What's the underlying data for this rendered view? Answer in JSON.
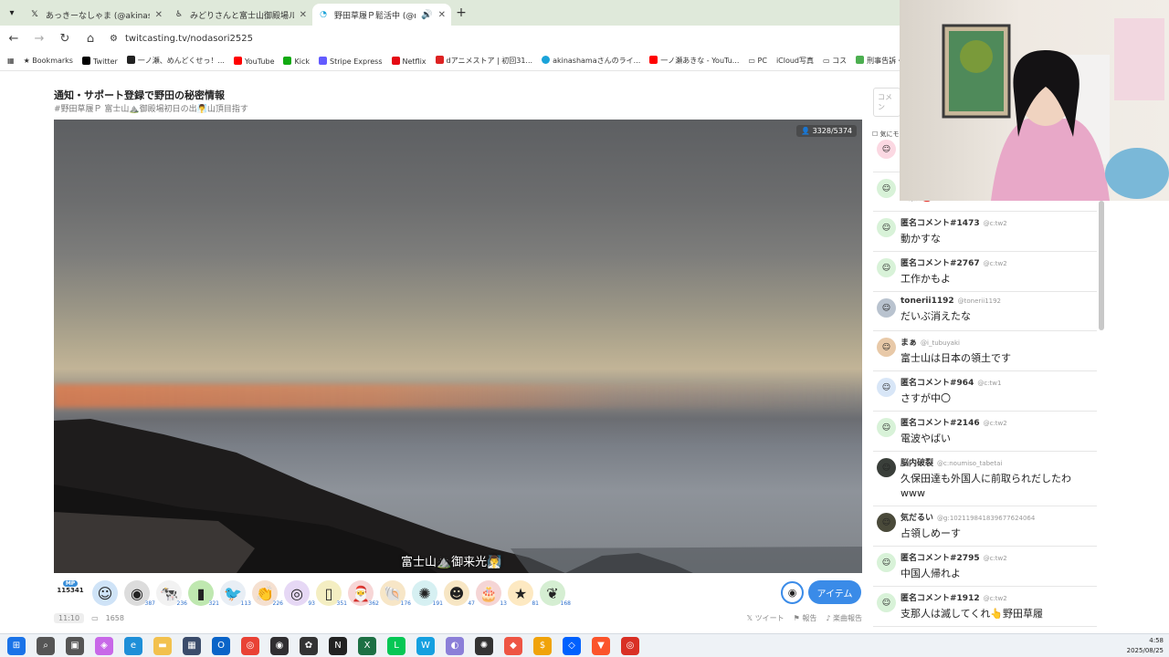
{
  "browser": {
    "tabs": [
      {
        "label": "あっきーなしゃま (@akinashama)",
        "icon": "x-logo-icon"
      },
      {
        "label": "みどりさんと富士山御殿場ルートの",
        "icon": "user-icon"
      },
      {
        "label": "野田草履Ｐ鬆活中 (@noda",
        "icon": "twitcasting-icon",
        "active": true
      }
    ],
    "url": "twitcasting.tv/nodasori2525",
    "bookmarks": [
      "Bookmarks",
      "Twitter",
      "一ノ瀬、めんどくせっ！...",
      "YouTube",
      "Kick",
      "Stripe Express",
      "Netflix",
      "dアニメストア | 初回31...",
      "akinashamaさんのライ...",
      "一ノ瀬あきな - YouTu...",
      "PC",
      "iCloud写真",
      "コス",
      "刑事告訴・ネ"
    ]
  },
  "page": {
    "title": "通知・サポート登録で野田の秘密情報",
    "subtitle": "#野田草履Ｐ 富士山⛰️御殿場初日の出🧖‍♂️山頂目指す",
    "viewers": "3328/5374",
    "caption": "富士山⛰️御来光🧖‍♂️"
  },
  "items": {
    "mp_label": "MP",
    "mp_value": "115341",
    "gifts": [
      {
        "icon": "smile-icon",
        "glyph": "☺",
        "color": "#cfe3f7",
        "count": ""
      },
      {
        "icon": "stone-icon",
        "glyph": "◉",
        "color": "#dcdcdc",
        "count": "387"
      },
      {
        "icon": "cow-icon",
        "glyph": "🐄",
        "color": "#f2f2f2",
        "count": "236"
      },
      {
        "icon": "card-icon",
        "glyph": "▮",
        "color": "#bfe8b0",
        "count": "321"
      },
      {
        "icon": "bird-icon",
        "glyph": "🐦",
        "color": "#e8eef5",
        "count": "113"
      },
      {
        "icon": "clap-icon",
        "glyph": "👏",
        "color": "#f5e0d0",
        "count": "226"
      },
      {
        "icon": "ring-icon",
        "glyph": "◎",
        "color": "#e6d8f5",
        "count": "93"
      },
      {
        "icon": "tea-icon",
        "glyph": "▯",
        "color": "#f4eec2",
        "count": "351"
      },
      {
        "icon": "santa-icon",
        "glyph": "🎅",
        "color": "#f7d6d6",
        "count": "362"
      },
      {
        "icon": "shell-icon",
        "glyph": "🐚",
        "color": "#f7e6c7",
        "count": "176"
      },
      {
        "icon": "firework-icon",
        "glyph": "✺",
        "color": "#d6f0f2",
        "count": "191"
      },
      {
        "icon": "face-icon",
        "glyph": "☻",
        "color": "#f7e6c4",
        "count": "47"
      },
      {
        "icon": "cake-icon",
        "glyph": "🎂",
        "color": "#f5d5d5",
        "count": "13"
      },
      {
        "icon": "star-icon",
        "glyph": "★",
        "color": "#fde9c2",
        "count": "81"
      },
      {
        "icon": "leaf-icon",
        "glyph": "❦",
        "color": "#d5eed2",
        "count": "168"
      }
    ],
    "item_button": "アイテム"
  },
  "meta": {
    "time": "11:10",
    "comment_count": "1658",
    "tweet": "ツイート",
    "report": "報告",
    "music_report": "楽曲報告"
  },
  "chat": {
    "input_placeholder": "コメン",
    "checkbox_label": "気にモ",
    "comments": [
      {
        "name": "",
        "id": "",
        "text": "",
        "avatar_color": "#fbd8e2"
      },
      {
        "name": "",
        "id": "",
        "text": "虫獄🔴",
        "avatar_color": "#d8f2d8"
      },
      {
        "name": "匿名コメント#1473",
        "id": "@c:tw2",
        "text": "動かすな",
        "avatar_color": "#d8f2d8"
      },
      {
        "name": "匿名コメント#2767",
        "id": "@c:tw2",
        "text": "工作かもよ",
        "avatar_color": "#d8f2d8"
      },
      {
        "name": "tonerii1192",
        "id": "@tonerii1192",
        "text": "だいぶ消えたな",
        "avatar_color": "#b9c3cf"
      },
      {
        "name": "まぁ",
        "id": "@i_tubuyaki",
        "text": "富士山は日本の領土です",
        "avatar_color": "#e8c9a8"
      },
      {
        "name": "匿名コメント#964",
        "id": "@c:tw1",
        "text": "さすが中〇",
        "avatar_color": "#d8e6f7"
      },
      {
        "name": "匿名コメント#2146",
        "id": "@c:tw2",
        "text": "電波やばい",
        "avatar_color": "#d8f2d8"
      },
      {
        "name": "脳内破裂",
        "id": "@c:noumiso_tabetai",
        "text": "久保田達も外国人に前取られだしたわwww",
        "avatar_color": "#3a3f3a"
      },
      {
        "name": "気だるい",
        "id": "@g:102119841839677624064",
        "text": "占領しめーす",
        "avatar_color": "#4a4a3a"
      },
      {
        "name": "匿名コメント#2795",
        "id": "@c:tw2",
        "text": "中国人帰れよ",
        "avatar_color": "#d8f2d8"
      },
      {
        "name": "匿名コメント#1912",
        "id": "@c:tw2",
        "text": "支那人は滅してくれ👆野田草履",
        "avatar_color": "#d8f2d8"
      }
    ]
  },
  "taskbar": {
    "time": "4:58",
    "date": "2025/08/25",
    "apps": [
      {
        "icon": "windows-start-icon",
        "color": "#1a73e8",
        "glyph": "⊞"
      },
      {
        "icon": "search-icon",
        "color": "#555",
        "glyph": "⌕"
      },
      {
        "icon": "task-view-icon",
        "color": "#555",
        "glyph": "▣"
      },
      {
        "icon": "copilot-icon",
        "color": "#c868e8",
        "glyph": "◈"
      },
      {
        "icon": "edge-icon",
        "color": "#1e8fd8",
        "glyph": "e"
      },
      {
        "icon": "folder-icon",
        "color": "#f2c14e",
        "glyph": "▬"
      },
      {
        "icon": "calculator-icon",
        "color": "#3b4c6b",
        "glyph": "▦"
      },
      {
        "icon": "outlook-icon",
        "color": "#0a64c8",
        "glyph": "O"
      },
      {
        "icon": "chrome-icon",
        "color": "#e94235",
        "glyph": "◎"
      },
      {
        "icon": "obs-icon",
        "color": "#302e31",
        "glyph": "◉"
      },
      {
        "icon": "app-icon",
        "color": "#333",
        "glyph": "✿"
      },
      {
        "icon": "ncv-icon",
        "color": "#222",
        "glyph": "N"
      },
      {
        "icon": "excel-icon",
        "color": "#1d7044",
        "glyph": "X"
      },
      {
        "icon": "line-icon",
        "color": "#06c755",
        "glyph": "L"
      },
      {
        "icon": "w-icon",
        "color": "#15a0e0",
        "glyph": "W"
      },
      {
        "icon": "safari-icon",
        "color": "#8b7fd8",
        "glyph": "◐"
      },
      {
        "icon": "chatgpt-icon",
        "color": "#333",
        "glyph": "✺"
      },
      {
        "icon": "game-icon",
        "color": "#e54",
        "glyph": "◆"
      },
      {
        "icon": "coin-icon",
        "color": "#f0a30a",
        "glyph": "$"
      },
      {
        "icon": "dropbox-icon",
        "color": "#0061fe",
        "glyph": "◇"
      },
      {
        "icon": "brave-icon",
        "color": "#fb542b",
        "glyph": "▼"
      },
      {
        "icon": "chrome-active-icon",
        "color": "#d93025",
        "glyph": "◎"
      }
    ]
  }
}
